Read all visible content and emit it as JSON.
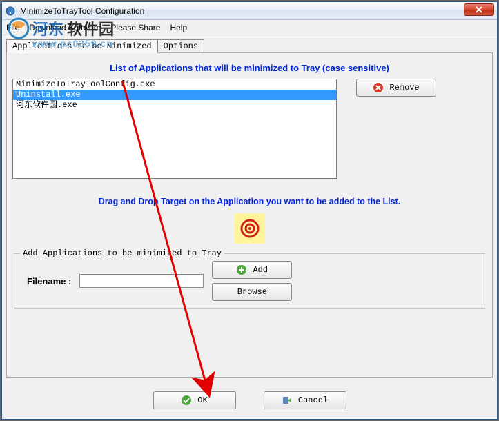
{
  "window": {
    "title": "MinimizeToTrayTool Configuration"
  },
  "menu": {
    "file": "File",
    "download": "Download Software",
    "share": "Please Share",
    "help": "Help"
  },
  "tabs": {
    "applications": "Applications to be Minimized",
    "options": "Options"
  },
  "section": {
    "list_title": "List of Applications that will be minimized to Tray (case sensitive)",
    "drag_text": "Drag and Drop Target on the Application you want to be added to the List.",
    "remove_label": "Remove"
  },
  "app_list": [
    {
      "name": "MinimizeToTrayToolConfig.exe",
      "selected": false
    },
    {
      "name": "Uninstall.exe",
      "selected": true
    },
    {
      "name": "河东软件园.exe",
      "selected": false
    }
  ],
  "add_group": {
    "legend": "Add Applications to be minimized to Tray",
    "filename_label": "Filename :",
    "filename_value": "",
    "add_label": "Add",
    "browse_label": "Browse"
  },
  "bottom": {
    "ok": "OK",
    "cancel": "Cancel"
  },
  "watermark": {
    "text_blue": "河东",
    "text_black": "软件园",
    "url": "www.pc0359.cn"
  },
  "colors": {
    "accent_blue": "#0026d8",
    "select_bg": "#3399ff"
  }
}
